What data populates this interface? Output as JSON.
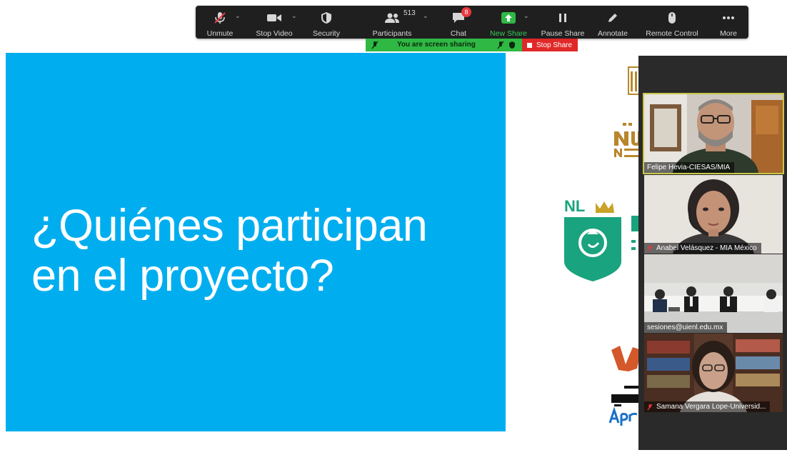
{
  "toolbar": {
    "unmute": "Unmute",
    "stop_video": "Stop Video",
    "security": "Security",
    "participants": "Participants",
    "participants_count": "513",
    "chat": "Chat",
    "chat_badge": "8",
    "new_share": "New Share",
    "pause_share": "Pause Share",
    "annotate": "Annotate",
    "remote_control": "Remote Control",
    "more": "More"
  },
  "share_banner": {
    "text": "You are screen sharing",
    "stop_label": "Stop Share"
  },
  "slide": {
    "title_line1": "¿Quiénes participan",
    "title_line2": "en el proyecto?"
  },
  "logos": {
    "nl": "NL"
  },
  "participants": [
    {
      "name": "Felipe Hevia-CIESAS/MIA",
      "muted": false,
      "active": true
    },
    {
      "name": "Anabel Velásquez - MIA México",
      "muted": true,
      "active": false
    },
    {
      "name": "sesiones@uienl.edu.mx",
      "muted": false,
      "active": false
    },
    {
      "name": "Samana Vergara Lope-Universid...",
      "muted": true,
      "active": false
    }
  ],
  "colors": {
    "slide_bg": "#00aeef",
    "toolbar_bg": "#1f1f1f",
    "share_green": "#2fb844",
    "stop_red": "#e02828",
    "active_speaker": "#c7c846",
    "nl_teal": "#1aa37f",
    "nl_gold": "#c9a227"
  }
}
